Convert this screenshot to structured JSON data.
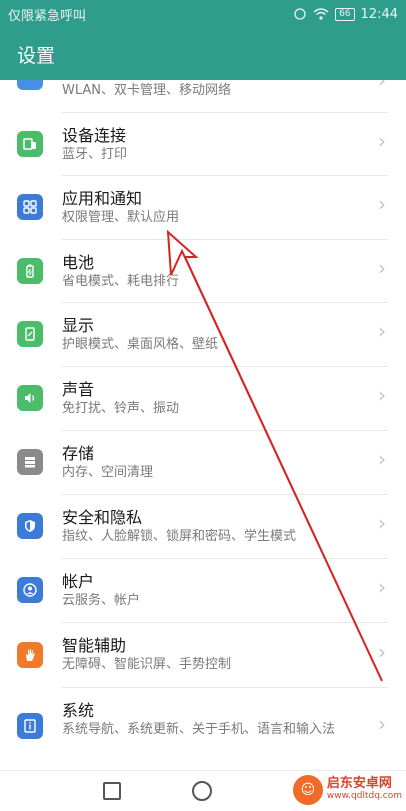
{
  "status_bar": {
    "carrier": "仅限紧急呼叫",
    "battery": "66",
    "time": "12:44"
  },
  "header": {
    "title": "设置"
  },
  "items": [
    {
      "title": "",
      "subtitle": "WLAN、双卡管理、移动网络",
      "icon": "network-icon",
      "color": "#4a90e2"
    },
    {
      "title": "设备连接",
      "subtitle": "蓝牙、打印",
      "icon": "device-connection-icon",
      "color": "#4cbb6a"
    },
    {
      "title": "应用和通知",
      "subtitle": "权限管理、默认应用",
      "icon": "apps-grid-icon",
      "color": "#3d7bd8"
    },
    {
      "title": "电池",
      "subtitle": "省电模式、耗电排行",
      "icon": "battery-icon",
      "color": "#4cbb6a"
    },
    {
      "title": "显示",
      "subtitle": "护眼模式、桌面风格、壁纸",
      "icon": "display-icon",
      "color": "#4cbb6a"
    },
    {
      "title": "声音",
      "subtitle": "免打扰、铃声、振动",
      "icon": "speaker-icon",
      "color": "#4cbb6a"
    },
    {
      "title": "存储",
      "subtitle": "内存、空间清理",
      "icon": "storage-icon",
      "color": "#8a8a8a"
    },
    {
      "title": "安全和隐私",
      "subtitle": "指纹、人脸解锁、锁屏和密码、学生模式",
      "icon": "shield-icon",
      "color": "#3d7bd8"
    },
    {
      "title": "帐户",
      "subtitle": "云服务、帐户",
      "icon": "account-icon",
      "color": "#3d7bd8"
    },
    {
      "title": "智能辅助",
      "subtitle": "无障碍、智能识屏、手势控制",
      "icon": "hand-icon",
      "color": "#f07a2a"
    },
    {
      "title": "系统",
      "subtitle": "系统导航、系统更新、关于手机、语言和输入法",
      "icon": "system-info-icon",
      "color": "#3d7bd8"
    }
  ],
  "watermark": {
    "name": "启东安卓网",
    "url": "www.qdltdq.com"
  }
}
